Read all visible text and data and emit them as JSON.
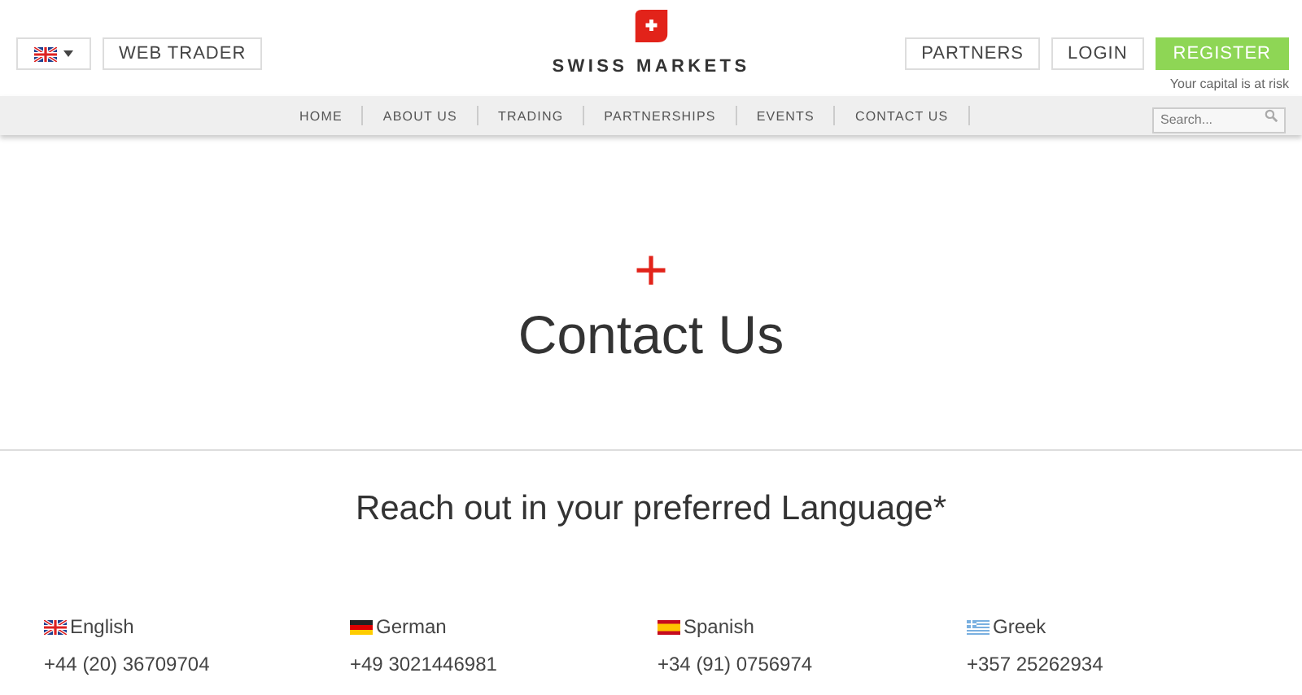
{
  "header": {
    "language_button": {
      "kind": "uk"
    },
    "web_trader": "WEB TRADER",
    "logo_text": "SWISS MARKETS",
    "partners": "PARTNERS",
    "login": "LOGIN",
    "register": "REGISTER",
    "risk_note": "Your capital is at risk"
  },
  "nav": {
    "items": [
      {
        "label": "HOME"
      },
      {
        "label": "ABOUT US"
      },
      {
        "label": "TRADING"
      },
      {
        "label": "PARTNERSHIPS"
      },
      {
        "label": "EVENTS"
      },
      {
        "label": "CONTACT US"
      }
    ],
    "search": {
      "placeholder": "Search..."
    }
  },
  "hero": {
    "plus": "+",
    "title": "Contact Us"
  },
  "section": {
    "heading": "Reach out in your preferred Language*",
    "languages": [
      {
        "kind": "uk",
        "name": "English",
        "phone": "+44 (20) 36709704"
      },
      {
        "kind": "de",
        "name": "German",
        "phone": "+49 3021446981"
      },
      {
        "kind": "es",
        "name": "Spanish",
        "phone": "+34 (91) 0756974"
      },
      {
        "kind": "gr",
        "name": "Greek",
        "phone": "+357 25262934"
      }
    ]
  }
}
